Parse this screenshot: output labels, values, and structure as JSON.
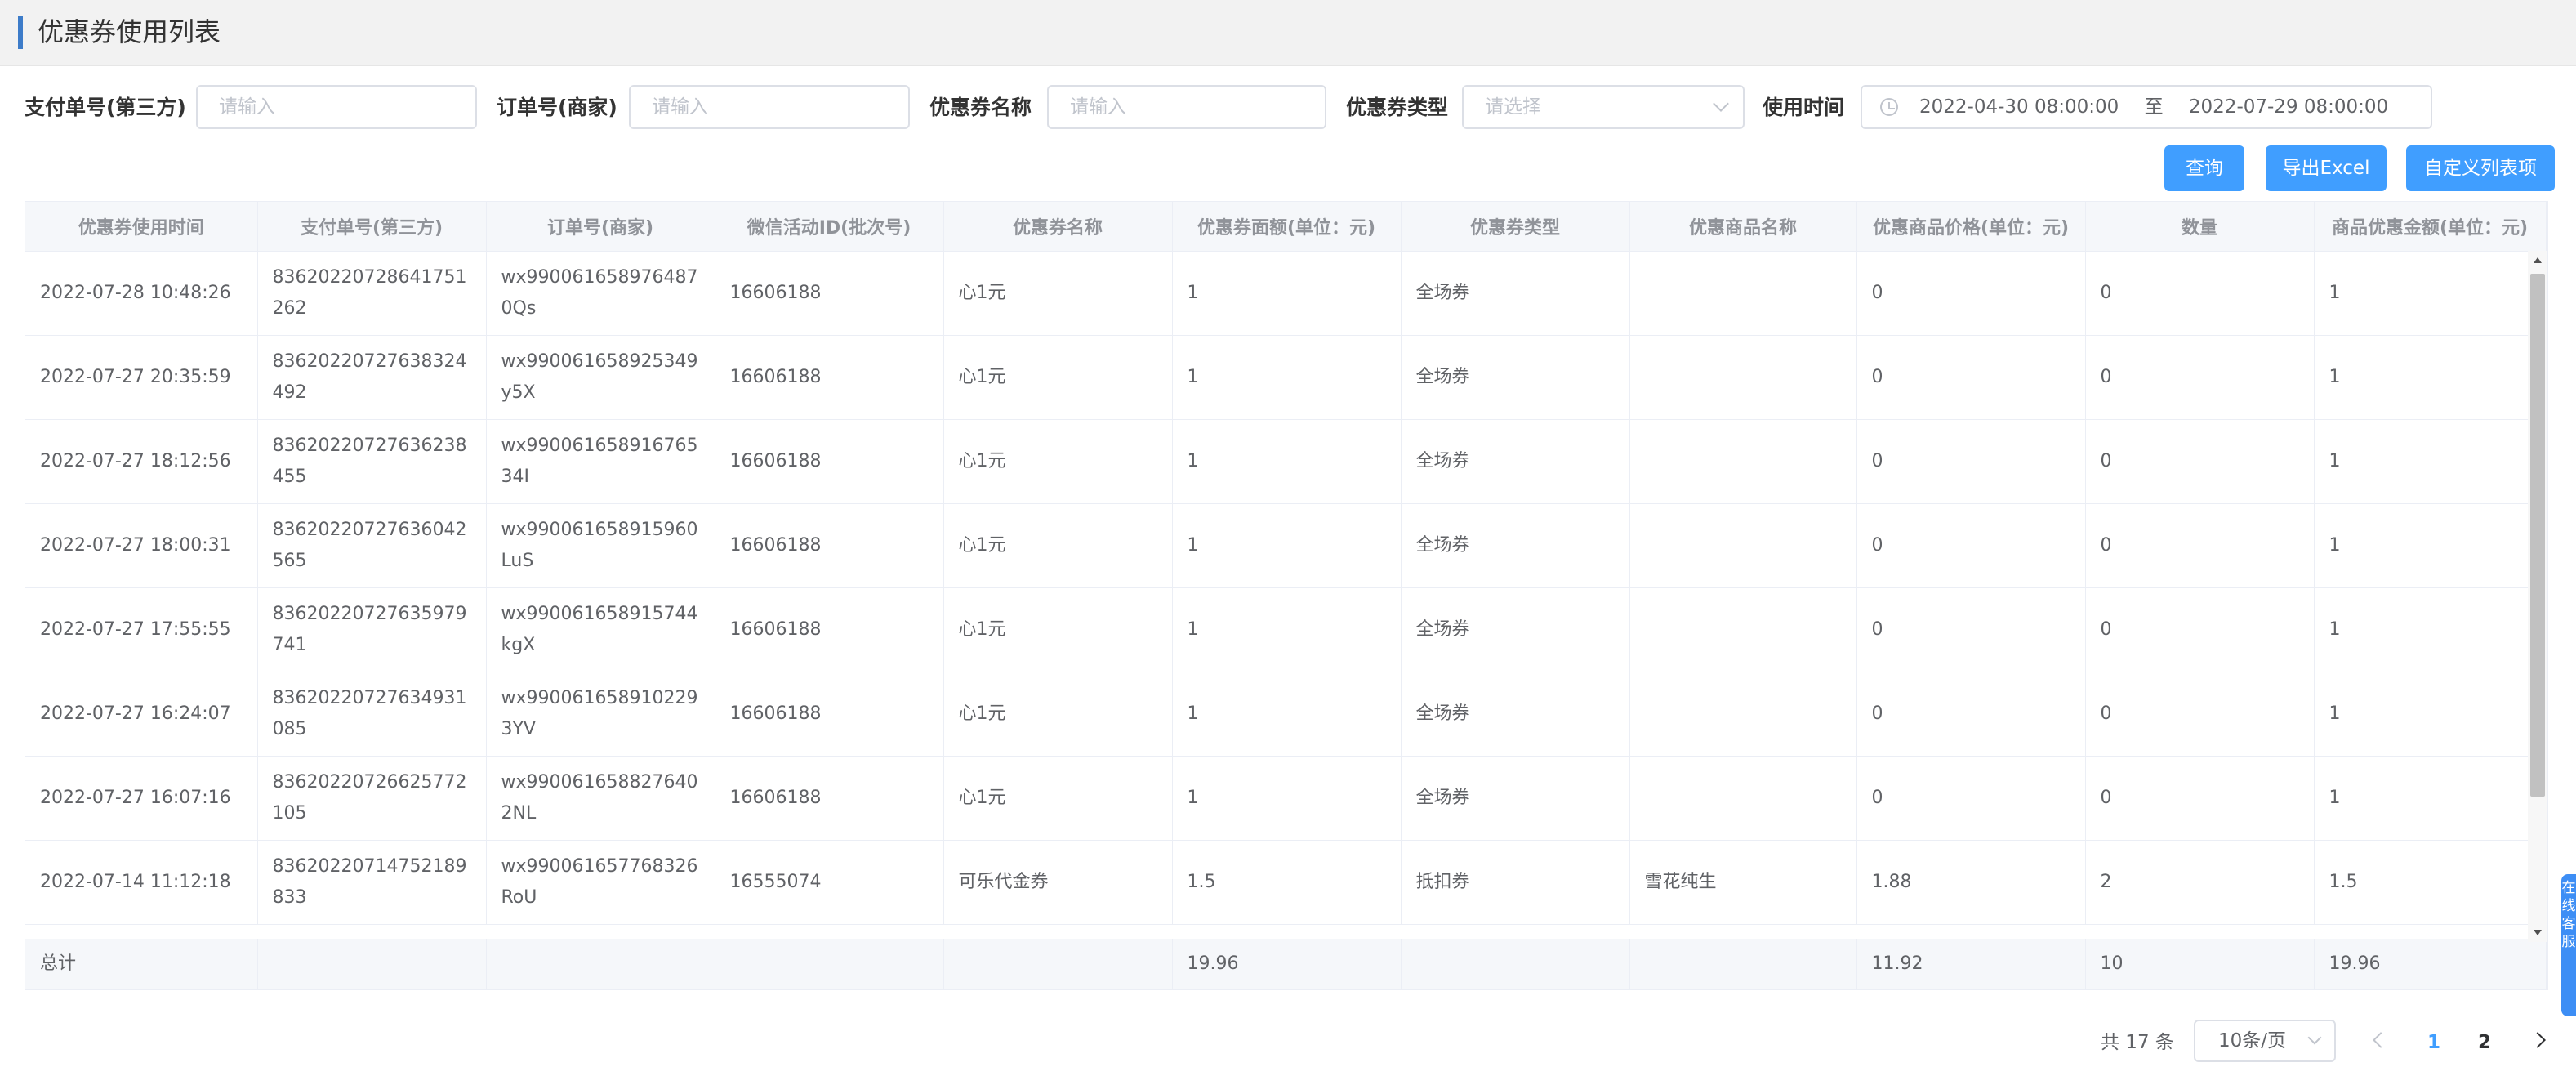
{
  "page": {
    "title": "优惠券使用列表"
  },
  "filters": {
    "pay_no": {
      "label": "支付单号(第三方)",
      "placeholder": "请输入"
    },
    "order_no": {
      "label": "订单号(商家)",
      "placeholder": "请输入"
    },
    "coupon_name": {
      "label": "优惠券名称",
      "placeholder": "请输入"
    },
    "coupon_type": {
      "label": "优惠券类型",
      "placeholder": "请选择"
    },
    "use_time": {
      "label": "使用时间",
      "start": "2022-04-30 08:00:00",
      "sep": "至",
      "end": "2022-07-29 08:00:00"
    }
  },
  "actions": {
    "query": "查询",
    "export": "导出Excel",
    "custom_columns": "自定义列表项"
  },
  "table": {
    "headers": [
      "优惠券使用时间",
      "支付单号(第三方)",
      "订单号(商家)",
      "微信活动ID(批次号)",
      "优惠券名称",
      "优惠券面额(单位：元)",
      "优惠券类型",
      "优惠商品名称",
      "优惠商品价格(单位：元)",
      "数量",
      "商品优惠金额(单位：元)"
    ],
    "rows": [
      [
        "2022-07-28 10:48:26",
        "83620220728641751262",
        "wx9900616589764870Qs",
        "16606188",
        "心1元",
        "1",
        "全场券",
        "",
        "0",
        "0",
        "1"
      ],
      [
        "2022-07-27 20:35:59",
        "83620220727638324492",
        "wx9900616589253​49y5X",
        "16606188",
        "心1元",
        "1",
        "全场券",
        "",
        "0",
        "0",
        "1"
      ],
      [
        "2022-07-27 18:12:56",
        "83620220727636238455",
        "wx99006165891676534I",
        "16606188",
        "心1元",
        "1",
        "全场券",
        "",
        "0",
        "0",
        "1"
      ],
      [
        "2022-07-27 18:00:31",
        "83620220727636042565",
        "wx9900616589159​60LuS",
        "16606188",
        "心1元",
        "1",
        "全场券",
        "",
        "0",
        "0",
        "1"
      ],
      [
        "2022-07-27 17:55:55",
        "83620220727635979741",
        "wx9900616589157​44kgX",
        "16606188",
        "心1元",
        "1",
        "全场券",
        "",
        "0",
        "0",
        "1"
      ],
      [
        "2022-07-27 16:24:07",
        "83620220727634931085",
        "wx9900616589102293YV",
        "16606188",
        "心1元",
        "1",
        "全场券",
        "",
        "0",
        "0",
        "1"
      ],
      [
        "2022-07-27 16:07:16",
        "83620220726625772105",
        "wx9900616588276402NL",
        "16606188",
        "心1元",
        "1",
        "全场券",
        "",
        "0",
        "0",
        "1"
      ],
      [
        "2022-07-14 11:12:18",
        "83620220714752189833",
        "wx9900616577683​26RoU",
        "16555074",
        "可乐代金券",
        "1.5",
        "抵扣券",
        "雪花纯生",
        "1.88",
        "2",
        "1.5"
      ]
    ],
    "total": [
      "总计",
      "",
      "",
      "",
      "",
      "19.96",
      "",
      "",
      "11.92",
      "10",
      "19.96"
    ]
  },
  "side_float": {
    "text": "在线客服"
  },
  "pagination": {
    "total": "共 17 条",
    "page_size": "10条/页",
    "pages": [
      "1",
      "2"
    ]
  },
  "colors": {
    "primary": "#409eff",
    "accent": "#3d7cc9"
  }
}
